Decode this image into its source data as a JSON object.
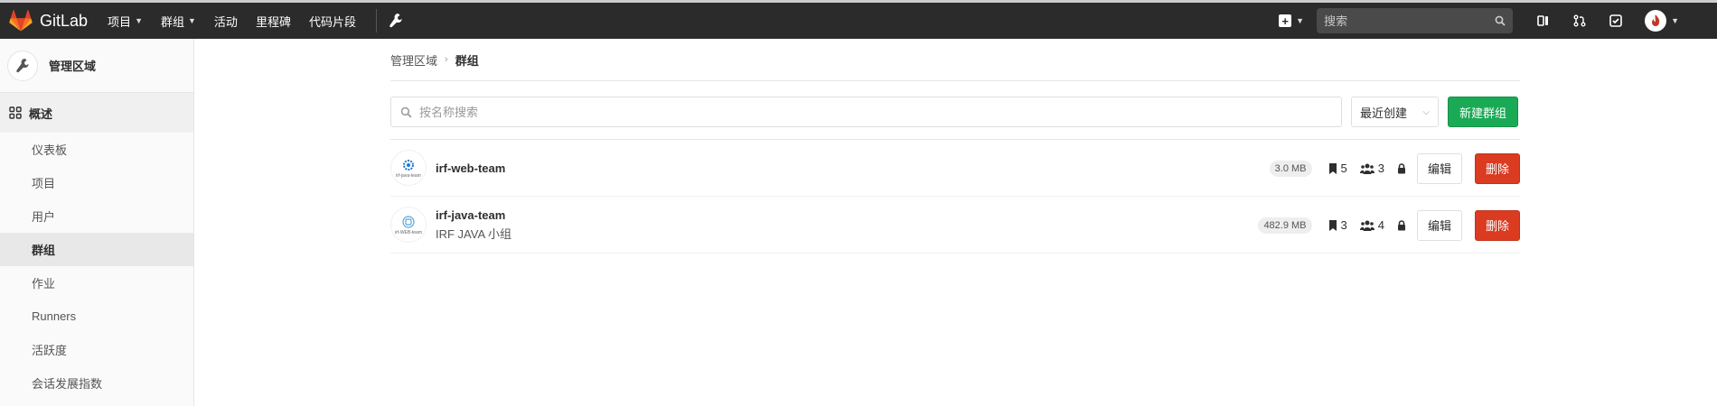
{
  "topbar": {
    "brand": "GitLab",
    "nav": [
      {
        "label": "项目",
        "caret": true
      },
      {
        "label": "群组",
        "caret": true
      },
      {
        "label": "活动",
        "caret": false
      },
      {
        "label": "里程碑",
        "caret": false
      },
      {
        "label": "代码片段",
        "caret": false
      }
    ],
    "search_placeholder": "搜索"
  },
  "sidebar": {
    "title": "管理区域",
    "section": "概述",
    "items": [
      {
        "label": "仪表板",
        "active": false
      },
      {
        "label": "项目",
        "active": false
      },
      {
        "label": "用户",
        "active": false
      },
      {
        "label": "群组",
        "active": true
      },
      {
        "label": "作业",
        "active": false
      },
      {
        "label": "Runners",
        "active": false
      },
      {
        "label": "活跃度",
        "active": false
      },
      {
        "label": "会话发展指数",
        "active": false
      }
    ]
  },
  "breadcrumb": {
    "root": "管理区域",
    "current": "群组"
  },
  "filter": {
    "placeholder": "按名称搜索",
    "sort_label": "最近创建",
    "new_group_label": "新建群组"
  },
  "groups": [
    {
      "name": "irf-web-team",
      "avatar_text": "irf-java-team",
      "description": "",
      "size": "3.0 MB",
      "projects": "5",
      "members": "3",
      "edit_label": "编辑",
      "delete_label": "删除"
    },
    {
      "name": "irf-java-team",
      "avatar_text": "irf-WEB-team",
      "description": "IRF JAVA 小组",
      "size": "482.9 MB",
      "projects": "3",
      "members": "4",
      "edit_label": "编辑",
      "delete_label": "删除"
    }
  ],
  "colors": {
    "navbar": "#2b2b2b",
    "success": "#1aaa55",
    "danger": "#db3b21"
  }
}
